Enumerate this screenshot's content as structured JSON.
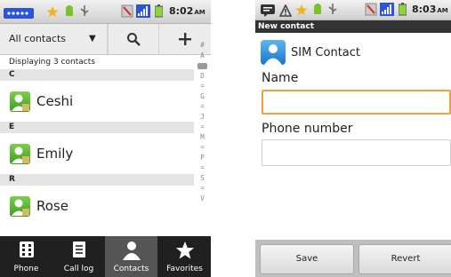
{
  "left": {
    "status": {
      "time": "8:02",
      "ampm": "AM"
    },
    "toolbar": {
      "filter_label": "All contacts"
    },
    "displaying": "Displaying 3 contacts",
    "sections": [
      {
        "letter": "C",
        "contact": "Ceshi"
      },
      {
        "letter": "E",
        "contact": "Emily"
      },
      {
        "letter": "R",
        "contact": "Rose"
      }
    ],
    "index_letters": [
      "#",
      "A",
      "",
      "D",
      "=",
      "G",
      "=",
      "J",
      "=",
      "M",
      "=",
      "P",
      "=",
      "S",
      "=",
      "V"
    ],
    "nav": [
      {
        "label": "Phone"
      },
      {
        "label": "Call log"
      },
      {
        "label": "Contacts"
      },
      {
        "label": "Favorites"
      }
    ]
  },
  "right": {
    "status": {
      "time": "8:03",
      "ampm": "AM"
    },
    "title": "New contact",
    "account": "SIM Contact",
    "name_label": "Name",
    "name_value": "",
    "phone_label": "Phone number",
    "phone_value": "",
    "save_label": "Save",
    "revert_label": "Revert"
  }
}
